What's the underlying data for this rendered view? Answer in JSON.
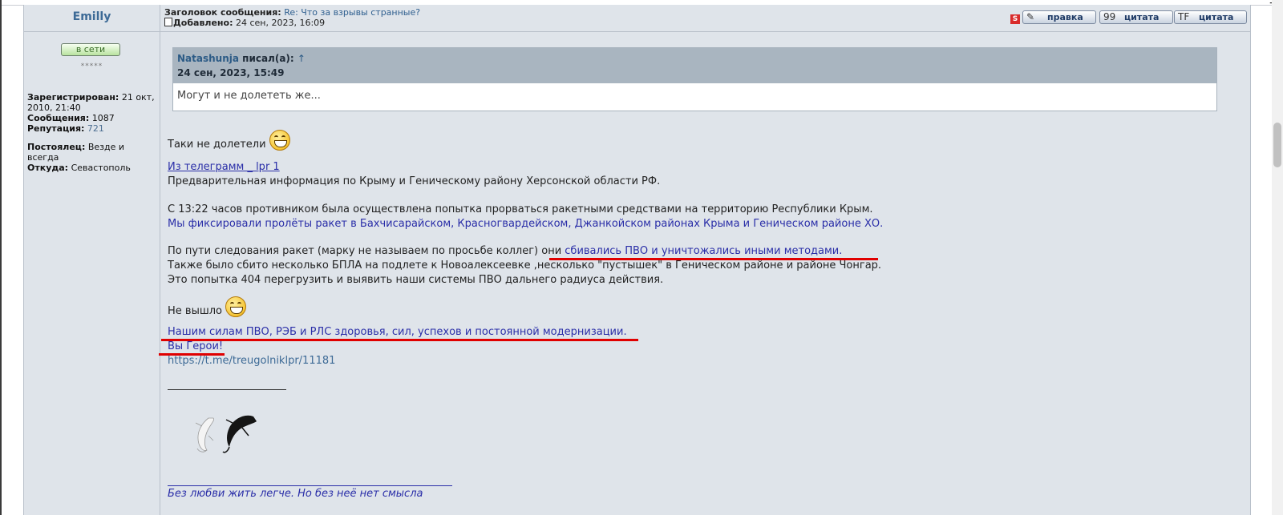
{
  "topbar": {
    "corner_glyph": "−"
  },
  "author": {
    "name": "Emilly",
    "online_badge": "в сети",
    "rank_stars": "*****",
    "profile": [
      {
        "label": "Зарегистрирован:",
        "value": "21 окт, 2010, 21:40"
      },
      {
        "label": "Сообщения:",
        "value": "1087"
      },
      {
        "label": "Репутация:",
        "value": "721"
      },
      {
        "label": "Постоялец:",
        "value": "Везде и всегда"
      },
      {
        "label": "Откуда:",
        "value": "Севастополь"
      }
    ]
  },
  "post": {
    "subject_label": "Заголовок сообщения:",
    "subject": "Re: Что за взрывы странные?",
    "added_label": "Добавлено:",
    "added": "24 сен, 2023, 16:09",
    "buttons": {
      "report_glyph": "S",
      "edit": "правка",
      "quote": "цитата",
      "quote2": "цитата",
      "quote_icon_text": "99",
      "quote2_icon_text": "TF"
    },
    "quote": {
      "author": "Natashunja",
      "wrote": " писал(а):",
      "arrow": "↑",
      "date": "24 сен, 2023, 15:49",
      "text": "Могут и не долететь же..."
    },
    "lines": {
      "l1": "Таки не долетели",
      "l2_link": "Из телеграмм _ lpr 1",
      "l3": "Предварительная информация по Крыму и Геническому району Херсонской области РФ.",
      "l4": "С 13:22 часов противником была осуществлена попытка прорваться ракетными средствами на территорию Республики Крым.",
      "l5": "Мы фиксировали пролёты ракет в Бахчисарайском, Красногвардейском, Джанкойском районах Крыма и Геническом районе ХО.",
      "l6a": "По пути следования ракет (марку не называем по просьбе коллег) ",
      "l6b": "они ",
      "l6c": "сбивались ПВО и уничтожались иными методами.",
      "l7": "Также было сбито несколько БПЛА на подлете к Новоалексеевке ,несколько \"пустышек\" в Геническом районе и районе Чонгар.",
      "l8": "Это попытка 404 перегрузить и выявить наши системы ПВО дальнего радиуса действия.",
      "l9": "Не вышло",
      "l10": "Нашим силам ПВО, РЭБ и РЛС здоровья, сил, успехов и постоянной модернизации.",
      "l11": "Вы Герои!",
      "l12": "https://t.me/treugolniklpr/11181"
    },
    "signature": "Без любви жить легче. Но без неё нет смысла"
  },
  "colors": {
    "post_bg": "#dfe4ea",
    "quote_head": "#a9b5c0",
    "link_blue": "#2a2ea8",
    "underline_red": "#e00000"
  }
}
